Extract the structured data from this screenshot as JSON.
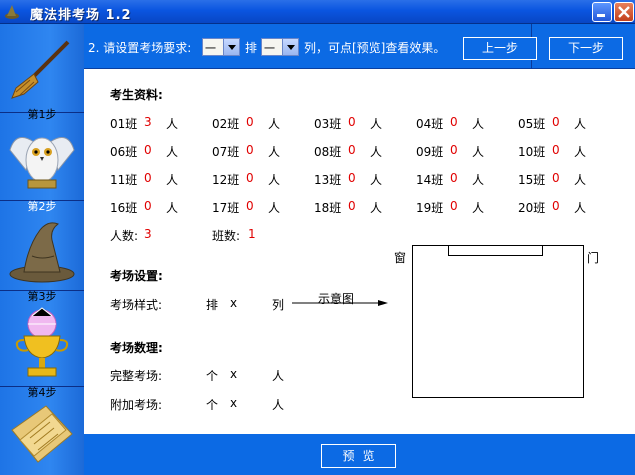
{
  "window": {
    "title": "魔法排考场  1.2"
  },
  "sidebar": {
    "steps": [
      {
        "label": "第1步",
        "icon": "broom-icon"
      },
      {
        "label": "第2步",
        "icon": "owl-icon"
      },
      {
        "label": "第3步",
        "icon": "wizard-hat-icon"
      },
      {
        "label": "第4步",
        "icon": "trophy-icon"
      },
      {
        "label": "",
        "icon": "scroll-icon"
      }
    ]
  },
  "topbar": {
    "instruction_pre": "2. 请设置考场要求:",
    "row_combo": "一",
    "row_unit": "排",
    "col_combo": "一",
    "col_suffix": "列，可点[预览]查看效果。",
    "prev_button": "上一步",
    "next_button": "下一步"
  },
  "students": {
    "heading": "考生资料:",
    "classes": [
      {
        "name": "01班",
        "count": "3",
        "unit": "人"
      },
      {
        "name": "02班",
        "count": "0",
        "unit": "人"
      },
      {
        "name": "03班",
        "count": "0",
        "unit": "人"
      },
      {
        "name": "04班",
        "count": "0",
        "unit": "人"
      },
      {
        "name": "05班",
        "count": "0",
        "unit": "人"
      },
      {
        "name": "06班",
        "count": "0",
        "unit": "人"
      },
      {
        "name": "07班",
        "count": "0",
        "unit": "人"
      },
      {
        "name": "08班",
        "count": "0",
        "unit": "人"
      },
      {
        "name": "09班",
        "count": "0",
        "unit": "人"
      },
      {
        "name": "10班",
        "count": "0",
        "unit": "人"
      },
      {
        "name": "11班",
        "count": "0",
        "unit": "人"
      },
      {
        "name": "12班",
        "count": "0",
        "unit": "人"
      },
      {
        "name": "13班",
        "count": "0",
        "unit": "人"
      },
      {
        "name": "14班",
        "count": "0",
        "unit": "人"
      },
      {
        "name": "15班",
        "count": "0",
        "unit": "人"
      },
      {
        "name": "16班",
        "count": "0",
        "unit": "人"
      },
      {
        "name": "17班",
        "count": "0",
        "unit": "人"
      },
      {
        "name": "18班",
        "count": "0",
        "unit": "人"
      },
      {
        "name": "19班",
        "count": "0",
        "unit": "人"
      },
      {
        "name": "20班",
        "count": "0",
        "unit": "人"
      }
    ],
    "total_label": "人数:",
    "total_value": "3",
    "class_count_label": "班数:",
    "class_count_value": "1"
  },
  "settings": {
    "heading": "考场设置:",
    "style_label": "考场样式:",
    "rows_unit": "排",
    "times": "x",
    "cols_unit": "列",
    "diagram_label": "示意图"
  },
  "counts": {
    "heading": "考场数理:",
    "full_label": "完整考场:",
    "extra_label": "附加考场:",
    "unit_count": "个",
    "times": "x",
    "unit_people": "人"
  },
  "diagram": {
    "window_label": "窗",
    "door_label": "门"
  },
  "bottombar": {
    "preview_button": "预览"
  },
  "colors": {
    "titlebar": "#0a55e0",
    "panel_blue": "#0c6ae4",
    "sidebar_blue": "#2f86f0",
    "count_red": "#e00000"
  }
}
